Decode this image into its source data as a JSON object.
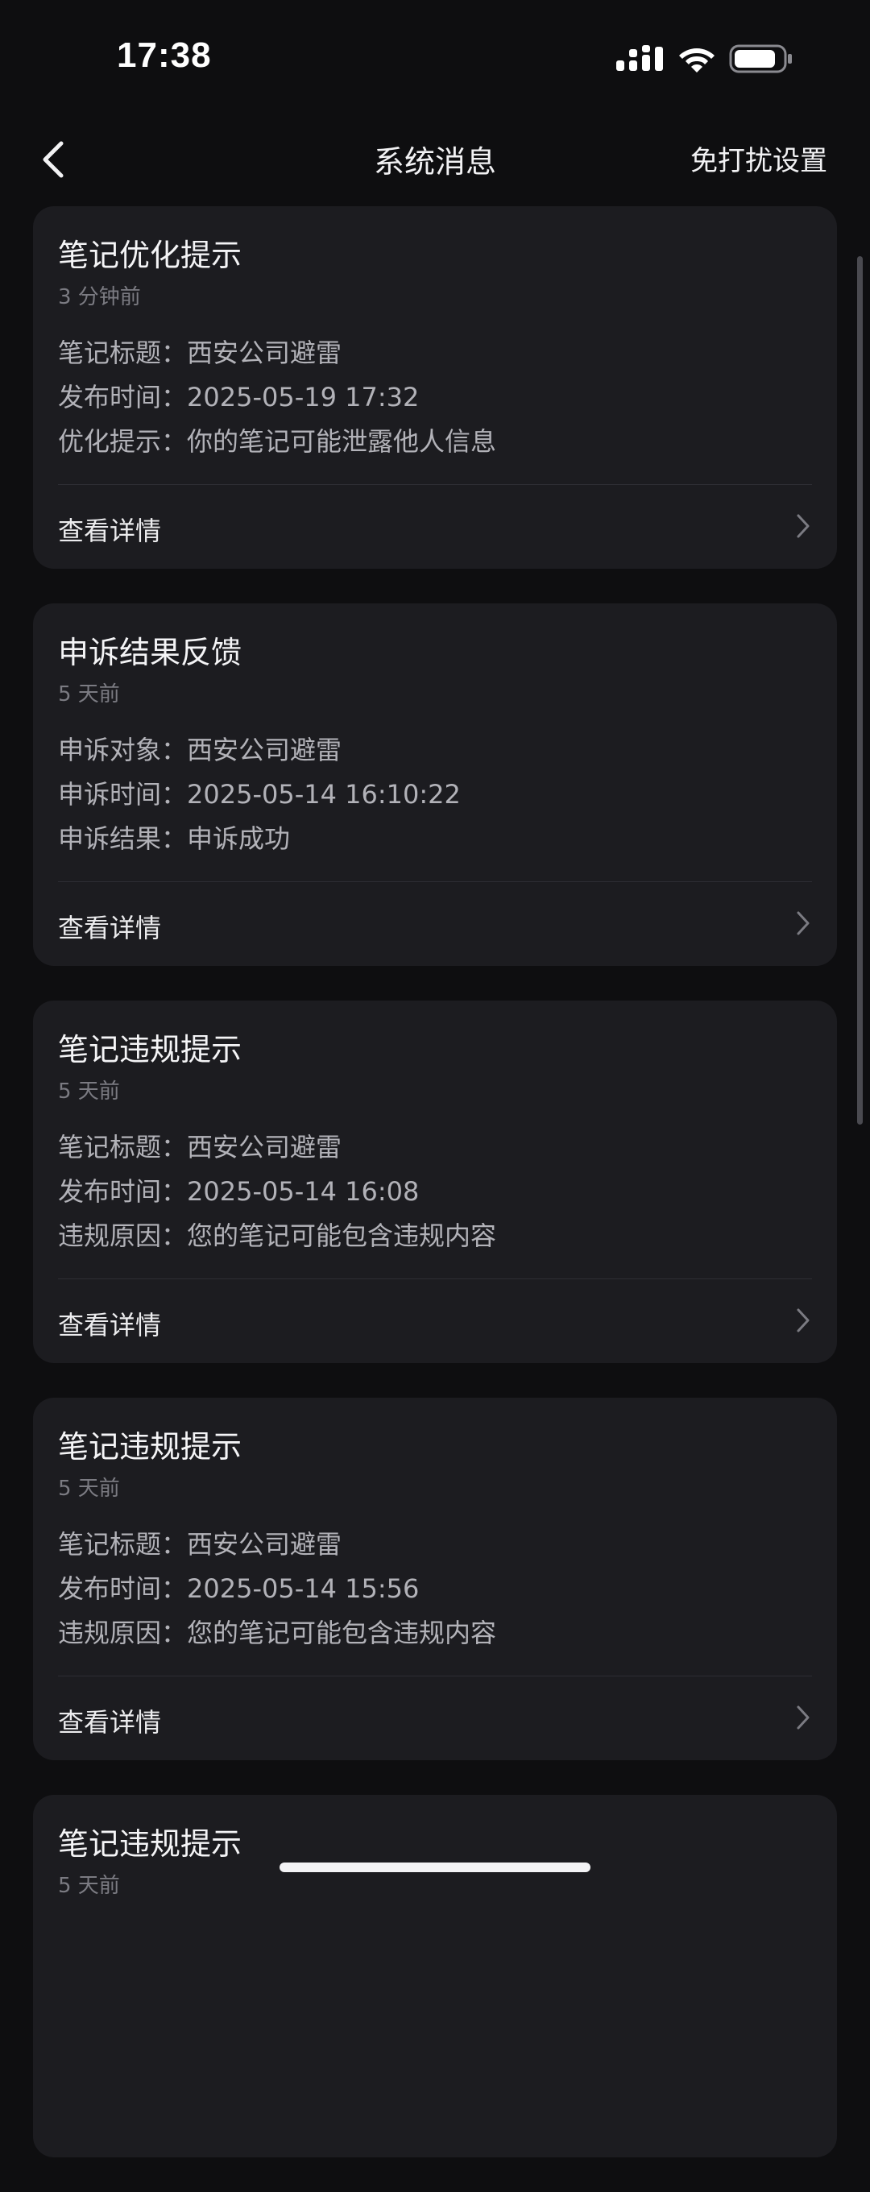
{
  "status_bar": {
    "time": "17:38"
  },
  "nav": {
    "title": "系统消息",
    "dnd_settings": "免打扰设置"
  },
  "messages": [
    {
      "title": "笔记优化提示",
      "time": "3 分钟前",
      "fields": [
        {
          "label": "笔记标题：",
          "value": "西安公司避雷"
        },
        {
          "label": "发布时间：",
          "value": "2025-05-19 17:32"
        },
        {
          "label": "优化提示：",
          "value": "你的笔记可能泄露他人信息"
        }
      ],
      "action": "查看详情"
    },
    {
      "title": "申诉结果反馈",
      "time": "5 天前",
      "fields": [
        {
          "label": "申诉对象：",
          "value": "西安公司避雷"
        },
        {
          "label": "申诉时间：",
          "value": "2025-05-14 16:10:22"
        },
        {
          "label": "申诉结果：",
          "value": "申诉成功"
        }
      ],
      "action": "查看详情"
    },
    {
      "title": "笔记违规提示",
      "time": "5 天前",
      "fields": [
        {
          "label": "笔记标题：",
          "value": "西安公司避雷"
        },
        {
          "label": "发布时间：",
          "value": "2025-05-14 16:08"
        },
        {
          "label": "违规原因：",
          "value": "您的笔记可能包含违规内容"
        }
      ],
      "action": "查看详情"
    },
    {
      "title": "笔记违规提示",
      "time": "5 天前",
      "fields": [
        {
          "label": "笔记标题：",
          "value": "西安公司避雷"
        },
        {
          "label": "发布时间：",
          "value": "2025-05-14 15:56"
        },
        {
          "label": "违规原因：",
          "value": "您的笔记可能包含违规内容"
        }
      ],
      "action": "查看详情"
    },
    {
      "title": "笔记违规提示",
      "time": "5 天前"
    }
  ]
}
